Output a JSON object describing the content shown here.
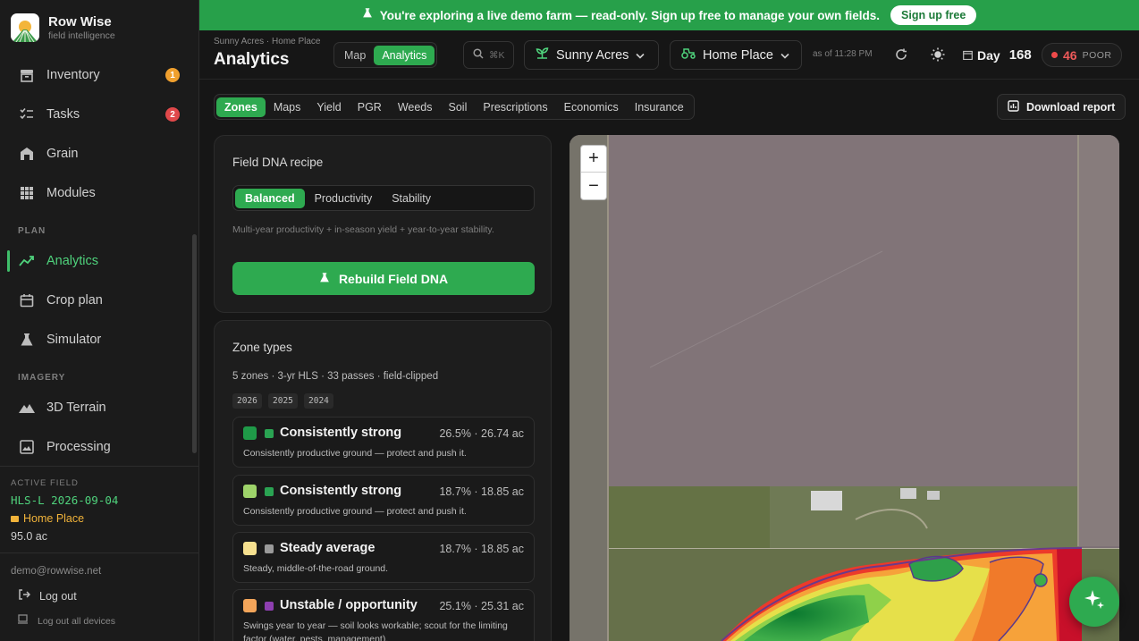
{
  "brand": {
    "name": "Row Wise",
    "subtitle": "field intelligence"
  },
  "sidebar": {
    "items": [
      {
        "label": "Inventory",
        "badge": "1",
        "badge_color": "#f0a02e"
      },
      {
        "label": "Tasks",
        "badge": "2",
        "badge_color": "#e0484a"
      },
      {
        "label": "Grain"
      },
      {
        "label": "Modules"
      },
      {
        "label": "Analytics"
      },
      {
        "label": "Crop plan"
      },
      {
        "label": "Simulator"
      },
      {
        "label": "3D Terrain"
      },
      {
        "label": "Processing"
      }
    ],
    "sections": {
      "plan": "PLAN",
      "imagery": "IMAGERY"
    },
    "active_field": {
      "caption": "ACTIVE FIELD",
      "name": "HLS-L 2026-09-04",
      "farm": "Home Place",
      "acres": "95.0 ac"
    },
    "account": {
      "email": "demo@rowwise.net",
      "logout": "Log out",
      "logout_all": "Log out all devices"
    }
  },
  "banner": {
    "text": "You're exploring a live demo farm — read-only. Sign up free to manage your own fields.",
    "cta": "Sign up free"
  },
  "header": {
    "breadcrumb": "Sunny Acres · Home Place",
    "title": "Analytics",
    "view_toggle": [
      "Map",
      "Analytics"
    ],
    "search_shortcut": "⌘K",
    "farm_select": "Sunny Acres",
    "field_select": "Home Place",
    "as_of": "as of 11:28 PM",
    "day_label": "Day",
    "day_value": "168",
    "score_value": "46",
    "score_status": "POOR"
  },
  "tabs": [
    "Zones",
    "Maps",
    "Yield",
    "PGR",
    "Weeds",
    "Soil",
    "Prescriptions",
    "Economics",
    "Insurance"
  ],
  "download_label": "Download report",
  "recipe": {
    "title": "Field DNA recipe",
    "options": [
      "Balanced",
      "Productivity",
      "Stability"
    ],
    "description": "Multi-year productivity + in-season yield + year-to-year stability.",
    "rebuild_label": "Rebuild Field DNA"
  },
  "zone_types": {
    "title": "Zone types",
    "meta": "5 zones · 3-yr HLS · 33 passes · field-clipped",
    "years": [
      "2026",
      "2025",
      "2024"
    ],
    "zones": [
      {
        "name": "Consistently strong",
        "value": "26.5% · 26.74 ac",
        "desc": "Consistently productive ground — protect and push it.",
        "color": "#1f9a48",
        "tag_color": "#2aa352"
      },
      {
        "name": "Consistently strong",
        "value": "18.7% · 18.85 ac",
        "desc": "Consistently productive ground — protect and push it.",
        "color": "#9ed36a",
        "tag_color": "#2aa352"
      },
      {
        "name": "Steady average",
        "value": "18.7% · 18.85 ac",
        "desc": "Steady, middle-of-the-road ground.",
        "color": "#f6e08f",
        "tag_color": "#9a9a9a"
      },
      {
        "name": "Unstable / opportunity",
        "value": "25.1% · 25.31 ac",
        "desc": "Swings year to year — soil looks workable; scout for the limiting factor (water, pests, management).",
        "color": "#f3a55a",
        "tag_color": "#8e3fb0"
      }
    ]
  },
  "map": {
    "zoom_in": "+",
    "zoom_out": "−"
  }
}
